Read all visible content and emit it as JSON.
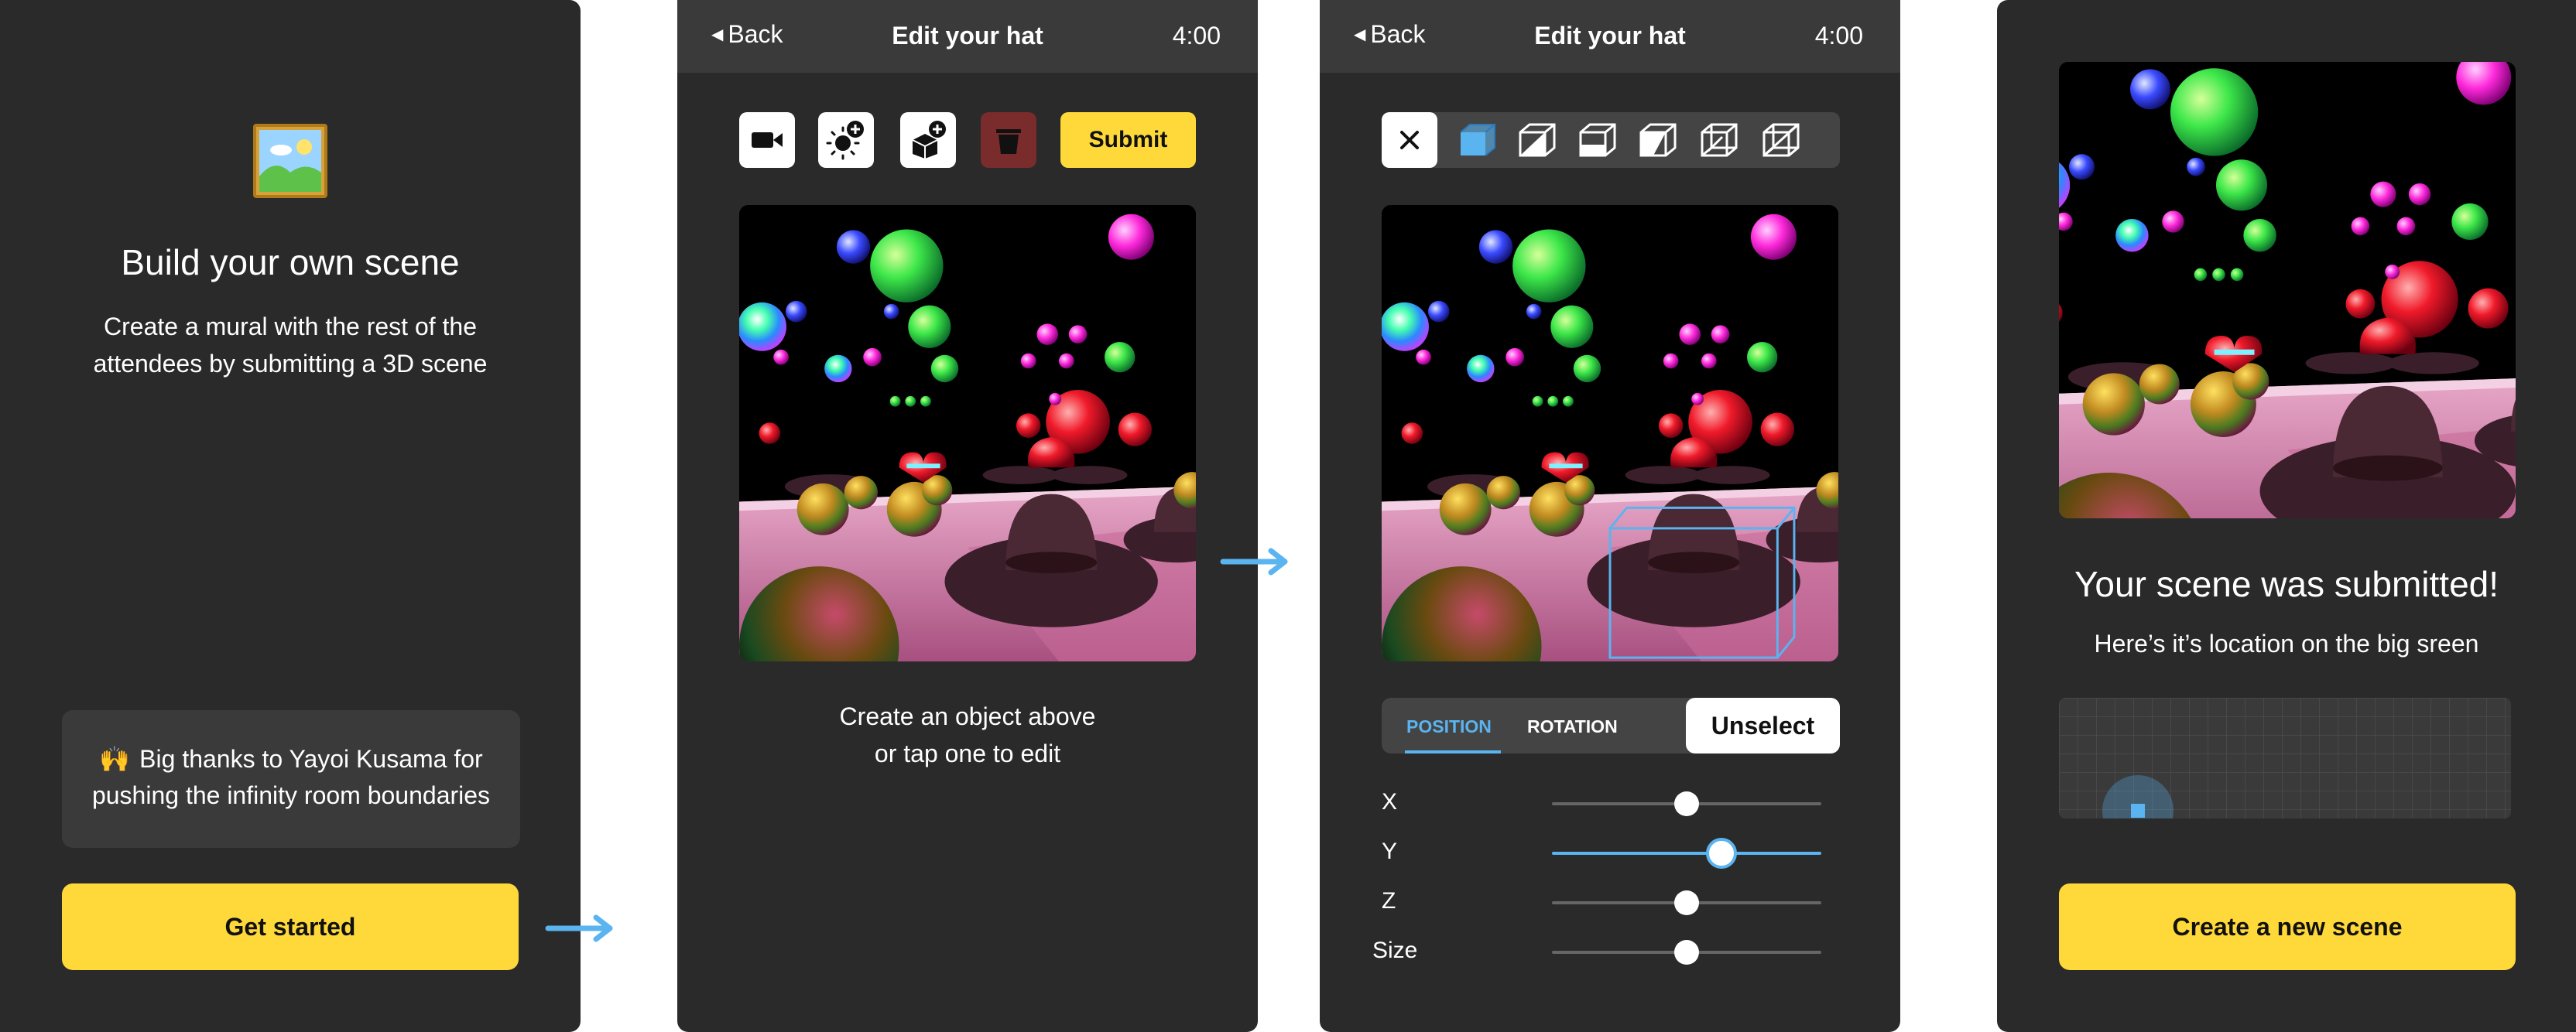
{
  "screen1": {
    "title": "Build your own scene",
    "description_line1": "Create a mural with the rest of the",
    "description_line2": "attendees by submitting a 3D scene",
    "thanks_emoji": "🙌",
    "thanks_line1": "Big thanks to Yayoi Kusama for",
    "thanks_line2": "pushing the infinity room boundaries",
    "cta": "Get started"
  },
  "screen2": {
    "back": "Back",
    "title": "Edit your hat",
    "timer": "4:00",
    "submit": "Submit",
    "hint_line1": "Create an object above",
    "hint_line2": "or tap one to edit"
  },
  "screen3": {
    "back": "Back",
    "title": "Edit your hat",
    "timer": "4:00",
    "tab_position": "POSITION",
    "tab_rotation": "ROTATION",
    "unselect": "Unselect",
    "sliders": [
      {
        "label": "X",
        "value": 0.5
      },
      {
        "label": "Y",
        "value": 0.63
      },
      {
        "label": "Z",
        "value": 0.5
      },
      {
        "label": "Size",
        "value": 0.5
      }
    ]
  },
  "screen4": {
    "title": "Your scene was submitted!",
    "subtitle": "Here’s it’s location on the big sreen",
    "cta": "Create a new scene"
  },
  "colors": {
    "accent_yellow": "#ffd83a",
    "accent_blue": "#5ab4f0",
    "panel_dark": "#2a2a2a",
    "navbar": "#3a3a3a",
    "delete_red": "#7a2b2b"
  },
  "icons": [
    "picture-icon",
    "video-camera-icon",
    "add-light-icon",
    "add-object-icon",
    "trash-icon",
    "close-icon",
    "cube-icon",
    "arrow-right-icon"
  ]
}
